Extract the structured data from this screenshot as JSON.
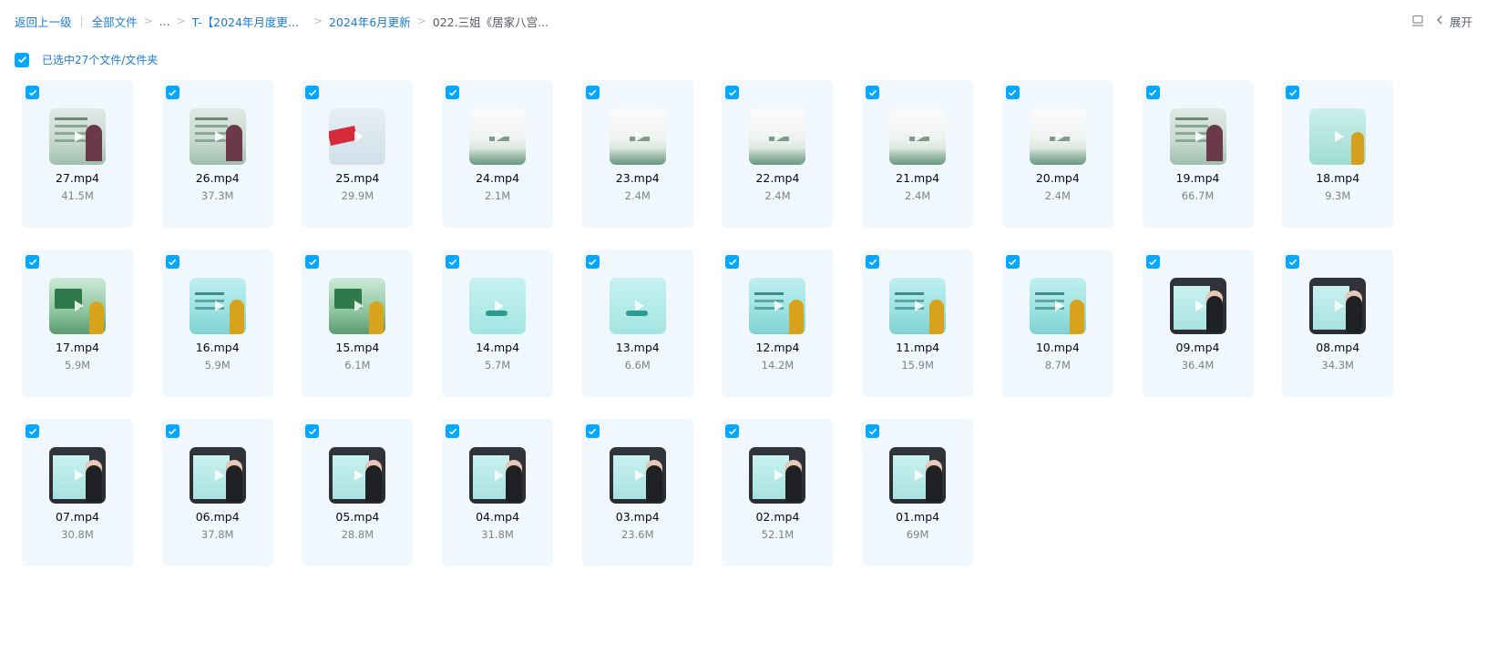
{
  "breadcrumb": {
    "back": "返回上一级",
    "items": [
      "全部文件",
      "...",
      "T-【2024年月度更...",
      "2024年6月更新",
      "022.三姐《居家八宫..."
    ],
    "separator": ">"
  },
  "toolbar": {
    "expand_label": "展开"
  },
  "selection": {
    "label": "已选中27个文件/文件夹"
  },
  "colors": {
    "accent": "#06a7ff",
    "link": "#1a7ad6",
    "card_bg": "#f0f8fd"
  },
  "files": [
    {
      "name": "27.mp4",
      "size": "41.5M",
      "thumb": "slide"
    },
    {
      "name": "26.mp4",
      "size": "37.3M",
      "thumb": "slide"
    },
    {
      "name": "25.mp4",
      "size": "29.9M",
      "thumb": "red"
    },
    {
      "name": "24.mp4",
      "size": "2.1M",
      "thumb": "title"
    },
    {
      "name": "23.mp4",
      "size": "2.4M",
      "thumb": "title"
    },
    {
      "name": "22.mp4",
      "size": "2.4M",
      "thumb": "title"
    },
    {
      "name": "21.mp4",
      "size": "2.4M",
      "thumb": "title"
    },
    {
      "name": "20.mp4",
      "size": "2.4M",
      "thumb": "title"
    },
    {
      "name": "19.mp4",
      "size": "66.7M",
      "thumb": "slide"
    },
    {
      "name": "18.mp4",
      "size": "9.3M",
      "thumb": "green-ink"
    },
    {
      "name": "17.mp4",
      "size": "5.9M",
      "thumb": "nature"
    },
    {
      "name": "16.mp4",
      "size": "5.9M",
      "thumb": "teal"
    },
    {
      "name": "15.mp4",
      "size": "6.1M",
      "thumb": "nature"
    },
    {
      "name": "14.mp4",
      "size": "5.7M",
      "thumb": "teal-text"
    },
    {
      "name": "13.mp4",
      "size": "6.6M",
      "thumb": "teal-text"
    },
    {
      "name": "12.mp4",
      "size": "14.2M",
      "thumb": "teal"
    },
    {
      "name": "11.mp4",
      "size": "15.9M",
      "thumb": "teal"
    },
    {
      "name": "10.mp4",
      "size": "8.7M",
      "thumb": "teal"
    },
    {
      "name": "09.mp4",
      "size": "36.4M",
      "thumb": "dark"
    },
    {
      "name": "08.mp4",
      "size": "34.3M",
      "thumb": "dark"
    },
    {
      "name": "07.mp4",
      "size": "30.8M",
      "thumb": "dark"
    },
    {
      "name": "06.mp4",
      "size": "37.8M",
      "thumb": "dark"
    },
    {
      "name": "05.mp4",
      "size": "28.8M",
      "thumb": "dark"
    },
    {
      "name": "04.mp4",
      "size": "31.8M",
      "thumb": "dark"
    },
    {
      "name": "03.mp4",
      "size": "23.6M",
      "thumb": "dark"
    },
    {
      "name": "02.mp4",
      "size": "52.1M",
      "thumb": "dark"
    },
    {
      "name": "01.mp4",
      "size": "69M",
      "thumb": "dark"
    }
  ]
}
